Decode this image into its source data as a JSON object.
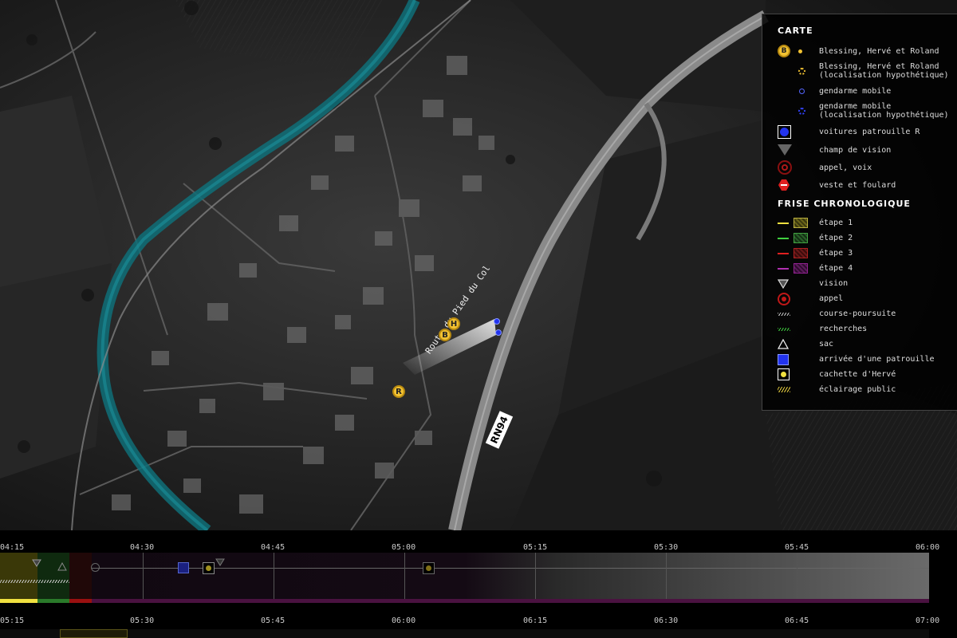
{
  "map": {
    "road_label": "Route du Pied du Col",
    "highway_label": "RN94",
    "markers": {
      "h": "H",
      "b": "B",
      "r": "R"
    }
  },
  "legend": {
    "carte_title": "CARTE",
    "carte_items": [
      {
        "icon": "b-marker-icon",
        "label": "Blessing, Hervé et Roland"
      },
      {
        "icon": "hypothetical-location-icon",
        "label": "Blessing, Hervé et Roland\n(localisation hypothétique)"
      },
      {
        "icon": "blue-dot-icon",
        "label": "gendarme mobile"
      },
      {
        "icon": "blue-hypothetical-icon",
        "label": "gendarme mobile\n(localisation hypothétique)"
      },
      {
        "icon": "blue-square-icon",
        "label": "voitures patrouille R"
      },
      {
        "icon": "vision-cone-icon",
        "label": "champ de vision"
      },
      {
        "icon": "call-target-icon",
        "label": "appel, voix"
      },
      {
        "icon": "red-hexagon-icon",
        "label": "veste et foulard"
      }
    ],
    "b_glyph": "B",
    "frise_title": "FRISE CHRONOLOGIQUE",
    "frise_items": [
      {
        "icon": "stage-1-icon",
        "label": "étape 1",
        "color": "#f0e040"
      },
      {
        "icon": "stage-2-icon",
        "label": "étape 2",
        "color": "#40d040"
      },
      {
        "icon": "stage-3-icon",
        "label": "étape 3",
        "color": "#e02020"
      },
      {
        "icon": "stage-4-icon",
        "label": "étape 4",
        "color": "#b030b0"
      },
      {
        "icon": "vision-icon",
        "label": "vision"
      },
      {
        "icon": "call-icon",
        "label": "appel"
      },
      {
        "icon": "chase-icon",
        "label": "course-poursuite"
      },
      {
        "icon": "search-hatch-icon",
        "label": "recherches"
      },
      {
        "icon": "bag-triangle-icon",
        "label": "sac"
      },
      {
        "icon": "patrol-arrival-icon",
        "label": "arrivée d'une patrouille"
      },
      {
        "icon": "hideout-icon",
        "label": "cachette d'Hervé"
      },
      {
        "icon": "street-lighting-icon",
        "label": "éclairage public"
      }
    ]
  },
  "timeline": {
    "row1": [
      "04:15",
      "04:30",
      "04:45",
      "05:00",
      "05:15",
      "05:30",
      "05:45",
      "06:00"
    ],
    "row2": [
      "05:15",
      "05:30",
      "05:45",
      "06:00",
      "06:15",
      "06:30",
      "06:45",
      "07:00"
    ]
  },
  "colors": {
    "marker": "#f2c232",
    "gendarme": "#2233ee",
    "river": "#0f6f78",
    "stage1": "#f0e040",
    "stage2": "#40d040",
    "stage3": "#e02020",
    "stage4": "#b030b0"
  }
}
